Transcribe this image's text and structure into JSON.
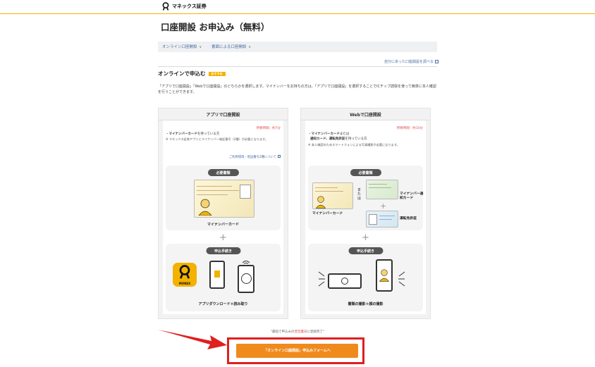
{
  "header": {
    "logo_text": "マネックス証券"
  },
  "page_title": "口座開設 お申込み（無料）",
  "subnav": {
    "items": [
      "オンライン口座開設",
      "書面による口座開設"
    ],
    "compare_link": "自分にあった口座開設を調べる"
  },
  "section": {
    "heading": "オンラインで申込む",
    "badge": "おすすめ",
    "intro": "「アプリで口座開設」「Webで口座開設」のどちらかを選択します。マイナンバーをお持ちの方は、「アプリで口座開設」を選択することでICチップ読取を使って簡単に本人確認を行うことができます。"
  },
  "cards": {
    "app": {
      "title": "アプリで口座開設",
      "time": "所要時間：約7分",
      "condition_prefix": "・",
      "condition_bold": "マイナンバーカード",
      "condition_suffix": "を持っている方",
      "note": "※ マネックス証券アプリとマイナンバー暗証番号（2種）が必要になります。",
      "detail_link": "ご利用環境・暗証番号2種について",
      "docs_pill": "必要書類",
      "doc_caption": "マイナンバーカード",
      "steps_pill": "申込手続き",
      "steps_caption": "アプリダウンロード＋読み取り",
      "monex_label": "MONEX"
    },
    "web": {
      "title": "Webで口座開設",
      "time": "所要時間：約10分",
      "condition_line1_prefix": "・",
      "condition_line1_bold": "マイナンバーカード",
      "condition_line1_suffix": "または",
      "condition_line2_bold": "通知カード、運転免許証",
      "condition_line2_suffix": "を持っている方",
      "note": "※ 本人確認のためスマートフォンによる写真撮影が必要になります。",
      "docs_pill": "必要書類",
      "doc_left_caption": "マイナンバーカード",
      "or_label": "または",
      "doc_right_caption1": "マイナンバー通知カード",
      "doc_right_caption2": "運転免許証",
      "steps_pill": "申込手続き",
      "steps_caption": "書類の撮影＋顔の撮影"
    }
  },
  "cta": {
    "note_prefix": "\"最短で申込みの",
    "note_red": "翌営業日",
    "note_suffix": "に登録完了\"",
    "button": "「オンライン口座開設」申込みフォームへ"
  },
  "colors": {
    "brand_yellow": "#f3b200",
    "cta_orange": "#f08a1c",
    "highlight_red": "#e01f1f",
    "link_blue": "#4a6fa5"
  }
}
